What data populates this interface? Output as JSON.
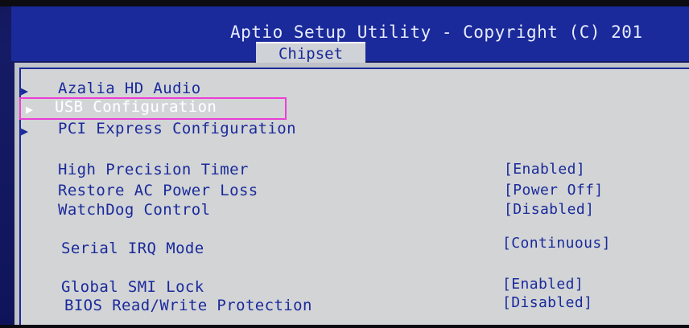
{
  "header": {
    "title": "Aptio Setup Utility - Copyright (C) 201",
    "active_tab": "Chipset"
  },
  "submenus": [
    {
      "label": "Azalia HD Audio",
      "icon": "triangle-right-icon"
    },
    {
      "label": "USB Configuration",
      "icon": "triangle-right-icon",
      "selected": true
    },
    {
      "label": "PCI Express Configuration",
      "icon": "triangle-right-icon"
    }
  ],
  "settings": [
    {
      "label": "High Precision Timer",
      "value": "[Enabled]"
    },
    {
      "label": "Restore AC Power Loss",
      "value": "[Power Off]"
    },
    {
      "label": "WatchDog Control",
      "value": "[Disabled]"
    },
    {
      "label": "Serial IRQ Mode",
      "value": "[Continuous]"
    },
    {
      "label": "Global SMI Lock",
      "value": "[Enabled]"
    },
    {
      "label": "BIOS Read/Write Protection",
      "value": "[Disabled]"
    }
  ],
  "colors": {
    "background": "#13185e",
    "panel": "#d2d4d6",
    "text": "#1a2a9a",
    "highlight_border": "#ec3ed6"
  }
}
